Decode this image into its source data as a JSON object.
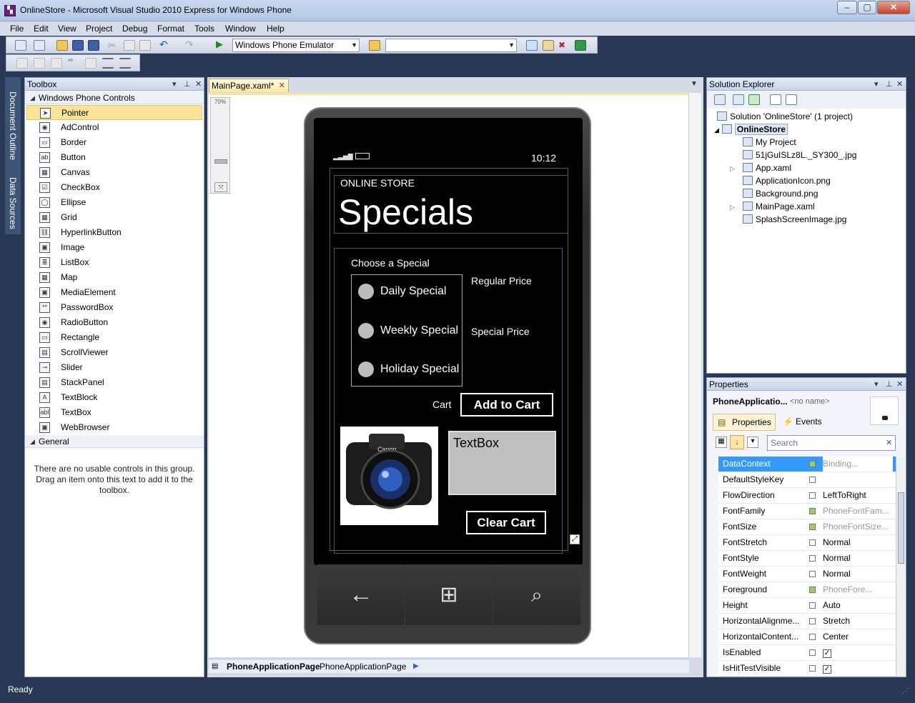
{
  "window": {
    "title": "OnlineStore - Microsoft Visual Studio 2010 Express for Windows Phone"
  },
  "menu": [
    "File",
    "Edit",
    "View",
    "Project",
    "Debug",
    "Format",
    "Tools",
    "Window",
    "Help"
  ],
  "toolbar": {
    "target": "Windows Phone Emulator",
    "search_value": ""
  },
  "side_tabs": {
    "document_outline": "Document Outline",
    "data_sources": "Data Sources"
  },
  "toolbox": {
    "title": "Toolbox",
    "group1": "Windows Phone Controls",
    "items": [
      "Pointer",
      "AdControl",
      "Border",
      "Button",
      "Canvas",
      "CheckBox",
      "Ellipse",
      "Grid",
      "HyperlinkButton",
      "Image",
      "ListBox",
      "Map",
      "MediaElement",
      "PasswordBox",
      "RadioButton",
      "Rectangle",
      "ScrollViewer",
      "Slider",
      "StackPanel",
      "TextBlock",
      "TextBox",
      "WebBrowser"
    ],
    "group2": "General",
    "general_text": "There are no usable controls in this group. Drag an item onto this text to add it to the toolbox."
  },
  "document": {
    "tab": "MainPage.xaml*",
    "zoom": "70%",
    "breadcrumb_bold": "PhoneApplicationPage",
    "breadcrumb": "PhoneApplicationPage"
  },
  "phone": {
    "time": "10:12",
    "app_title": "ONLINE STORE",
    "page_title": "Specials",
    "choose": "Choose a Special",
    "radios": [
      "Daily Special",
      "Weekly Special",
      "Holiday Special"
    ],
    "regular_price": "Regular Price",
    "special_price": "Special Price",
    "cart": "Cart",
    "add_to_cart": "Add to Cart",
    "textbox": "TextBox",
    "clear_cart": "Clear Cart",
    "camera_brand": "Canon"
  },
  "solution": {
    "title": "Solution Explorer",
    "root": "Solution 'OnlineStore' (1 project)",
    "project": "OnlineStore",
    "files": [
      "My Project",
      "51jGuISLz8L._SY300_.jpg",
      "App.xaml",
      "ApplicationIcon.png",
      "Background.png",
      "MainPage.xaml",
      "SplashScreenImage.jpg"
    ]
  },
  "properties": {
    "title": "Properties",
    "object": "PhoneApplicatio...",
    "name": "<no name>",
    "tab_props": "Properties",
    "tab_events": "Events",
    "search_placeholder": "Search",
    "rows": [
      {
        "name": "DataContext",
        "value": "Binding..."
      },
      {
        "name": "DefaultStyleKey",
        "value": ""
      },
      {
        "name": "FlowDirection",
        "value": "LeftToRight"
      },
      {
        "name": "FontFamily",
        "value": "PhoneFontFam..."
      },
      {
        "name": "FontSize",
        "value": "PhoneFontSize..."
      },
      {
        "name": "FontStretch",
        "value": "Normal"
      },
      {
        "name": "FontStyle",
        "value": "Normal"
      },
      {
        "name": "FontWeight",
        "value": "Normal"
      },
      {
        "name": "Foreground",
        "value": "PhoneFore..."
      },
      {
        "name": "Height",
        "value": "Auto"
      },
      {
        "name": "HorizontalAlignme...",
        "value": "Stretch"
      },
      {
        "name": "HorizontalContent...",
        "value": "Center"
      },
      {
        "name": "IsEnabled",
        "value": ""
      },
      {
        "name": "IsHitTestVisible",
        "value": ""
      }
    ]
  },
  "status": "Ready"
}
